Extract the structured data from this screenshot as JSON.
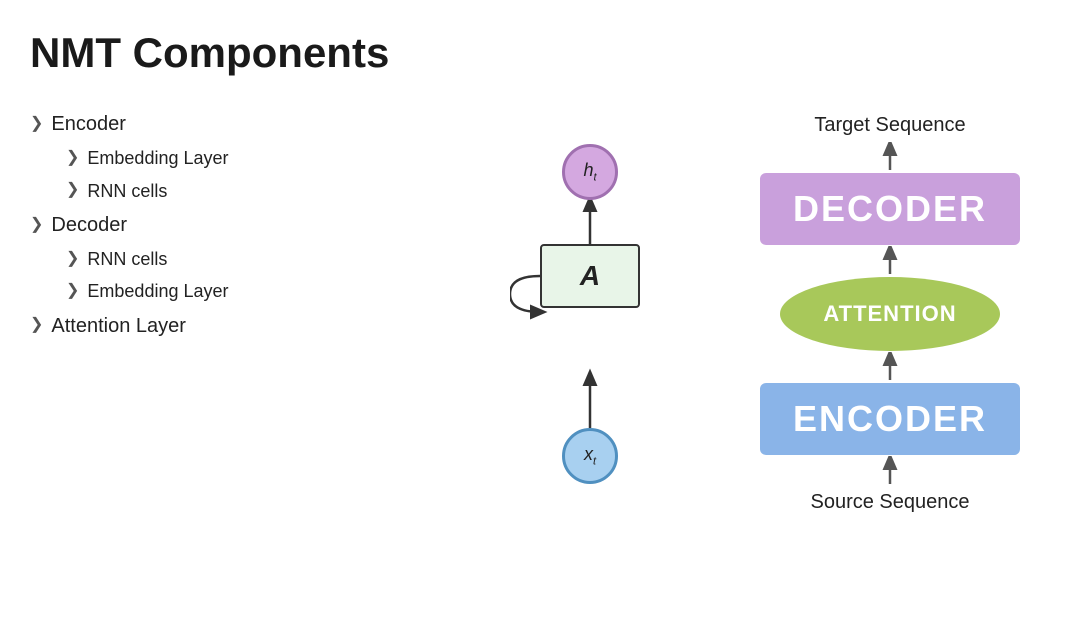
{
  "title": "NMT Components",
  "outline": {
    "items": [
      {
        "label": "Encoder",
        "level": 1
      },
      {
        "label": "Embedding Layer",
        "level": 2
      },
      {
        "label": "RNN cells",
        "level": 2
      },
      {
        "label": "Decoder",
        "level": 1
      },
      {
        "label": "RNN cells",
        "level": 2
      },
      {
        "label": "Embedding Layer",
        "level": 2
      },
      {
        "label": "Attention Layer",
        "level": 1
      }
    ]
  },
  "diagram": {
    "ht_label": "h",
    "ht_subscript": "t",
    "a_label": "A",
    "xt_label": "x",
    "xt_subscript": "t"
  },
  "arch": {
    "target_label": "Target Sequence",
    "decoder_label": "DECODER",
    "attention_label": "ATTENTION",
    "encoder_label": "ENCODER",
    "source_label": "Source Sequence"
  }
}
